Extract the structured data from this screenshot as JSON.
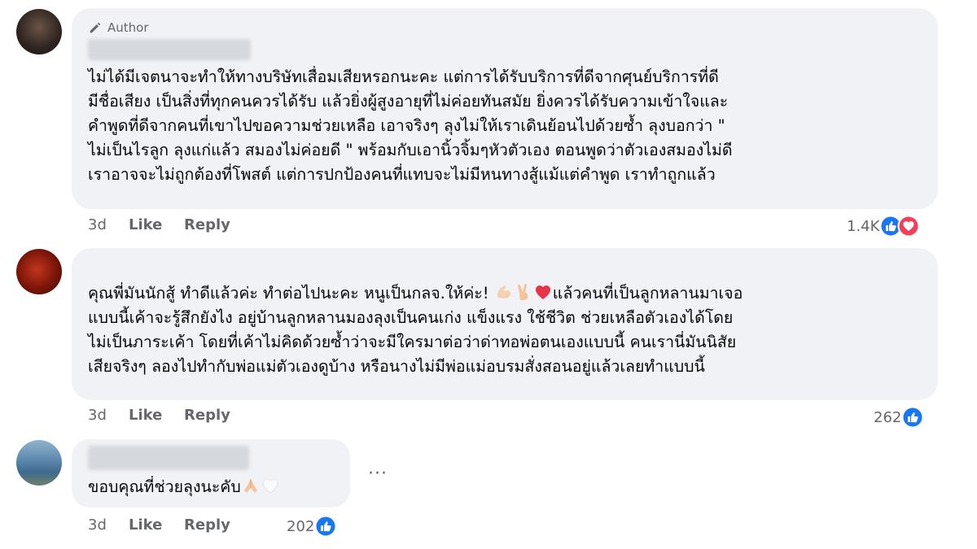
{
  "comments": [
    {
      "badge": "Author",
      "text": "ไม่ได้มีเจตนาจะทำให้ทางบริษัทเสื่อมเสียหรอกนะคะ แต่การได้รับบริการที่ดีจากศุนย์บริการที่ดี\nมีชื่อเสียง เป็นสิ่งที่ทุกคนควรได้รับ แล้วยิ่งผู้สูงอายุที่ไม่ค่อยทันสมัย ยิ่งควรได้รับความเข้าใจและ\nคำพูดที่ดีจากคนที่เขาไปขอความช่วยเหลือ เอาจริงๆ ลุงไม่ให้เราเดินย้อนไปด้วยซ้ำ ลุงบอกว่า \"\nไม่เป็นไรลูก ลุงแก่แล้ว สมองไม่ค่อยดี \" พร้อมกับเอานิ้วจิ้มๆหัวตัวเอง ตอนพูดว่าตัวเองสมองไม่ดี\nเราอาจจะไม่ถูกต้องที่โพสต์ แต่การปกป้องคนที่แทบจะไม่มีหนทางสู้แม้แต่คำพูด เราทำถูกแล้ว",
      "time": "3d",
      "like": "Like",
      "reply": "Reply",
      "reaction_count": "1.4K",
      "reaction_icons": [
        "like-reaction-icon",
        "love-reaction-icon"
      ]
    },
    {
      "text_line1_a": "คุณพี่มันนักสู้ ทำดีแล้วค่ะ ทำต่อไปนะคะ หนูเป็นกลจ.ให้ค่ะ! ",
      "emojis": [
        "flexed-biceps-emoji",
        "victory-hand-emoji",
        "red-heart-emoji"
      ],
      "text_line1_b": "แล้วคนที่เป็นลูกหลานมาเจอ",
      "text_rest": "แบบนี้เค้าจะรู้สึกยังไง อยู่บ้านลูกหลานมองลุงเป็นคนเก่ง แข็งแรง ใช้ชีวิต ช่วยเหลือตัวเองได้โดย\nไม่เป็นภาระเค้า โดยที่เค้าไม่คิดด้วยซ้ำว่าจะมีใครมาต่อว่าด่าทอพ่อตนเองแบบนี้ คนเรานี่มันนิสัย\nเสียจริงๆ ลองไปทำกับพ่อแม่ตัวเองดูบ้าง หรือนางไม่มีพ่อแม่อบรมสั่งสอนอยู่แล้วเลยทำแบบนี้",
      "time": "3d",
      "like": "Like",
      "reply": "Reply",
      "reaction_count": "262",
      "reaction_icons": [
        "like-reaction-icon"
      ]
    },
    {
      "text": "ขอบคุณที่ช่วยลุงนะคับ",
      "emojis": [
        "folded-hands-emoji",
        "white-heart-emoji"
      ],
      "time": "3d",
      "like": "Like",
      "reply": "Reply",
      "reaction_count": "202",
      "reaction_icons": [
        "like-reaction-icon"
      ],
      "more": "···"
    }
  ],
  "colors": {
    "bubble": "#f0f2f5",
    "meta": "#65676b",
    "like_blue": "#1877f2",
    "love_red": "#f33e58"
  }
}
